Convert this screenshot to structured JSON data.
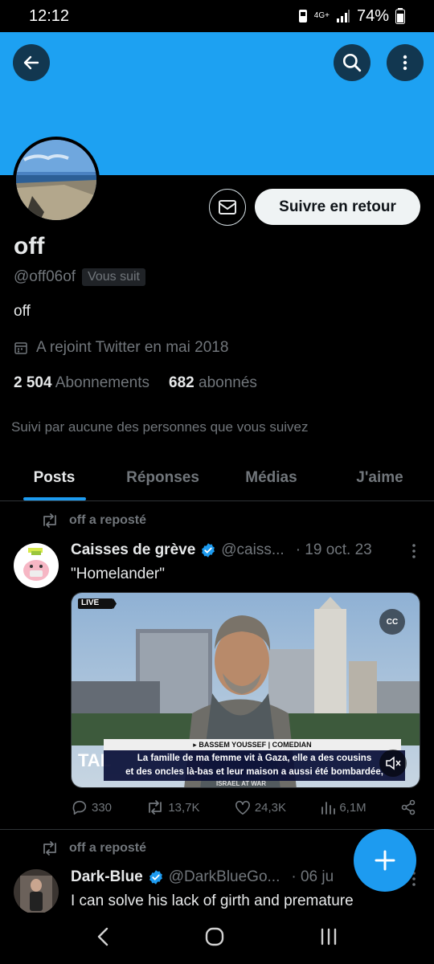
{
  "status_bar": {
    "time": "12:12",
    "network": "4G+",
    "battery": "74%"
  },
  "profile": {
    "name": "off",
    "handle": "@off06of",
    "follows_you_badge": "Vous suit",
    "bio": "off",
    "joined": "A rejoint Twitter en mai 2018",
    "following_count": "2 504",
    "following_label": "Abonnements",
    "followers_count": "682",
    "followers_label": "abonnés",
    "followed_by": "Suivi par aucune des personnes que vous suivez",
    "follow_back_label": "Suivre en retour"
  },
  "tabs": [
    {
      "label": "Posts",
      "active": true
    },
    {
      "label": "Réponses",
      "active": false
    },
    {
      "label": "Médias",
      "active": false
    },
    {
      "label": "J'aime",
      "active": false
    }
  ],
  "tweets": [
    {
      "repost_label": "off a reposté",
      "name": "Caisses de grève",
      "handle": "@caiss...",
      "date": "· 19 oct. 23",
      "text": "\"Homelander\"",
      "media": {
        "live_badge": "LIVE",
        "lower_third_name": "▸ BASSEM YOUSSEF | COMEDIAN",
        "caption_line1": "La famille de ma femme vit à Gaza, elle a des cousins",
        "caption_line2": "et des oncles là-bas et leur maison a aussi été bombardée,",
        "cc_label": "CC",
        "ticker_left": "TAL",
        "ticker_bottom": "ISRAEL AT WAR"
      },
      "replies": "330",
      "reposts": "13,7K",
      "likes": "24,3K",
      "views": "6,1M"
    },
    {
      "repost_label": "off a reposté",
      "name": "Dark-Blue",
      "handle": "@DarkBlueGo...",
      "date": "· 06 ju",
      "text": "I can solve his lack of girth and premature"
    }
  ],
  "colors": {
    "accent": "#1d9bf0",
    "banner": "#1da1f2",
    "muted": "#71767b"
  }
}
